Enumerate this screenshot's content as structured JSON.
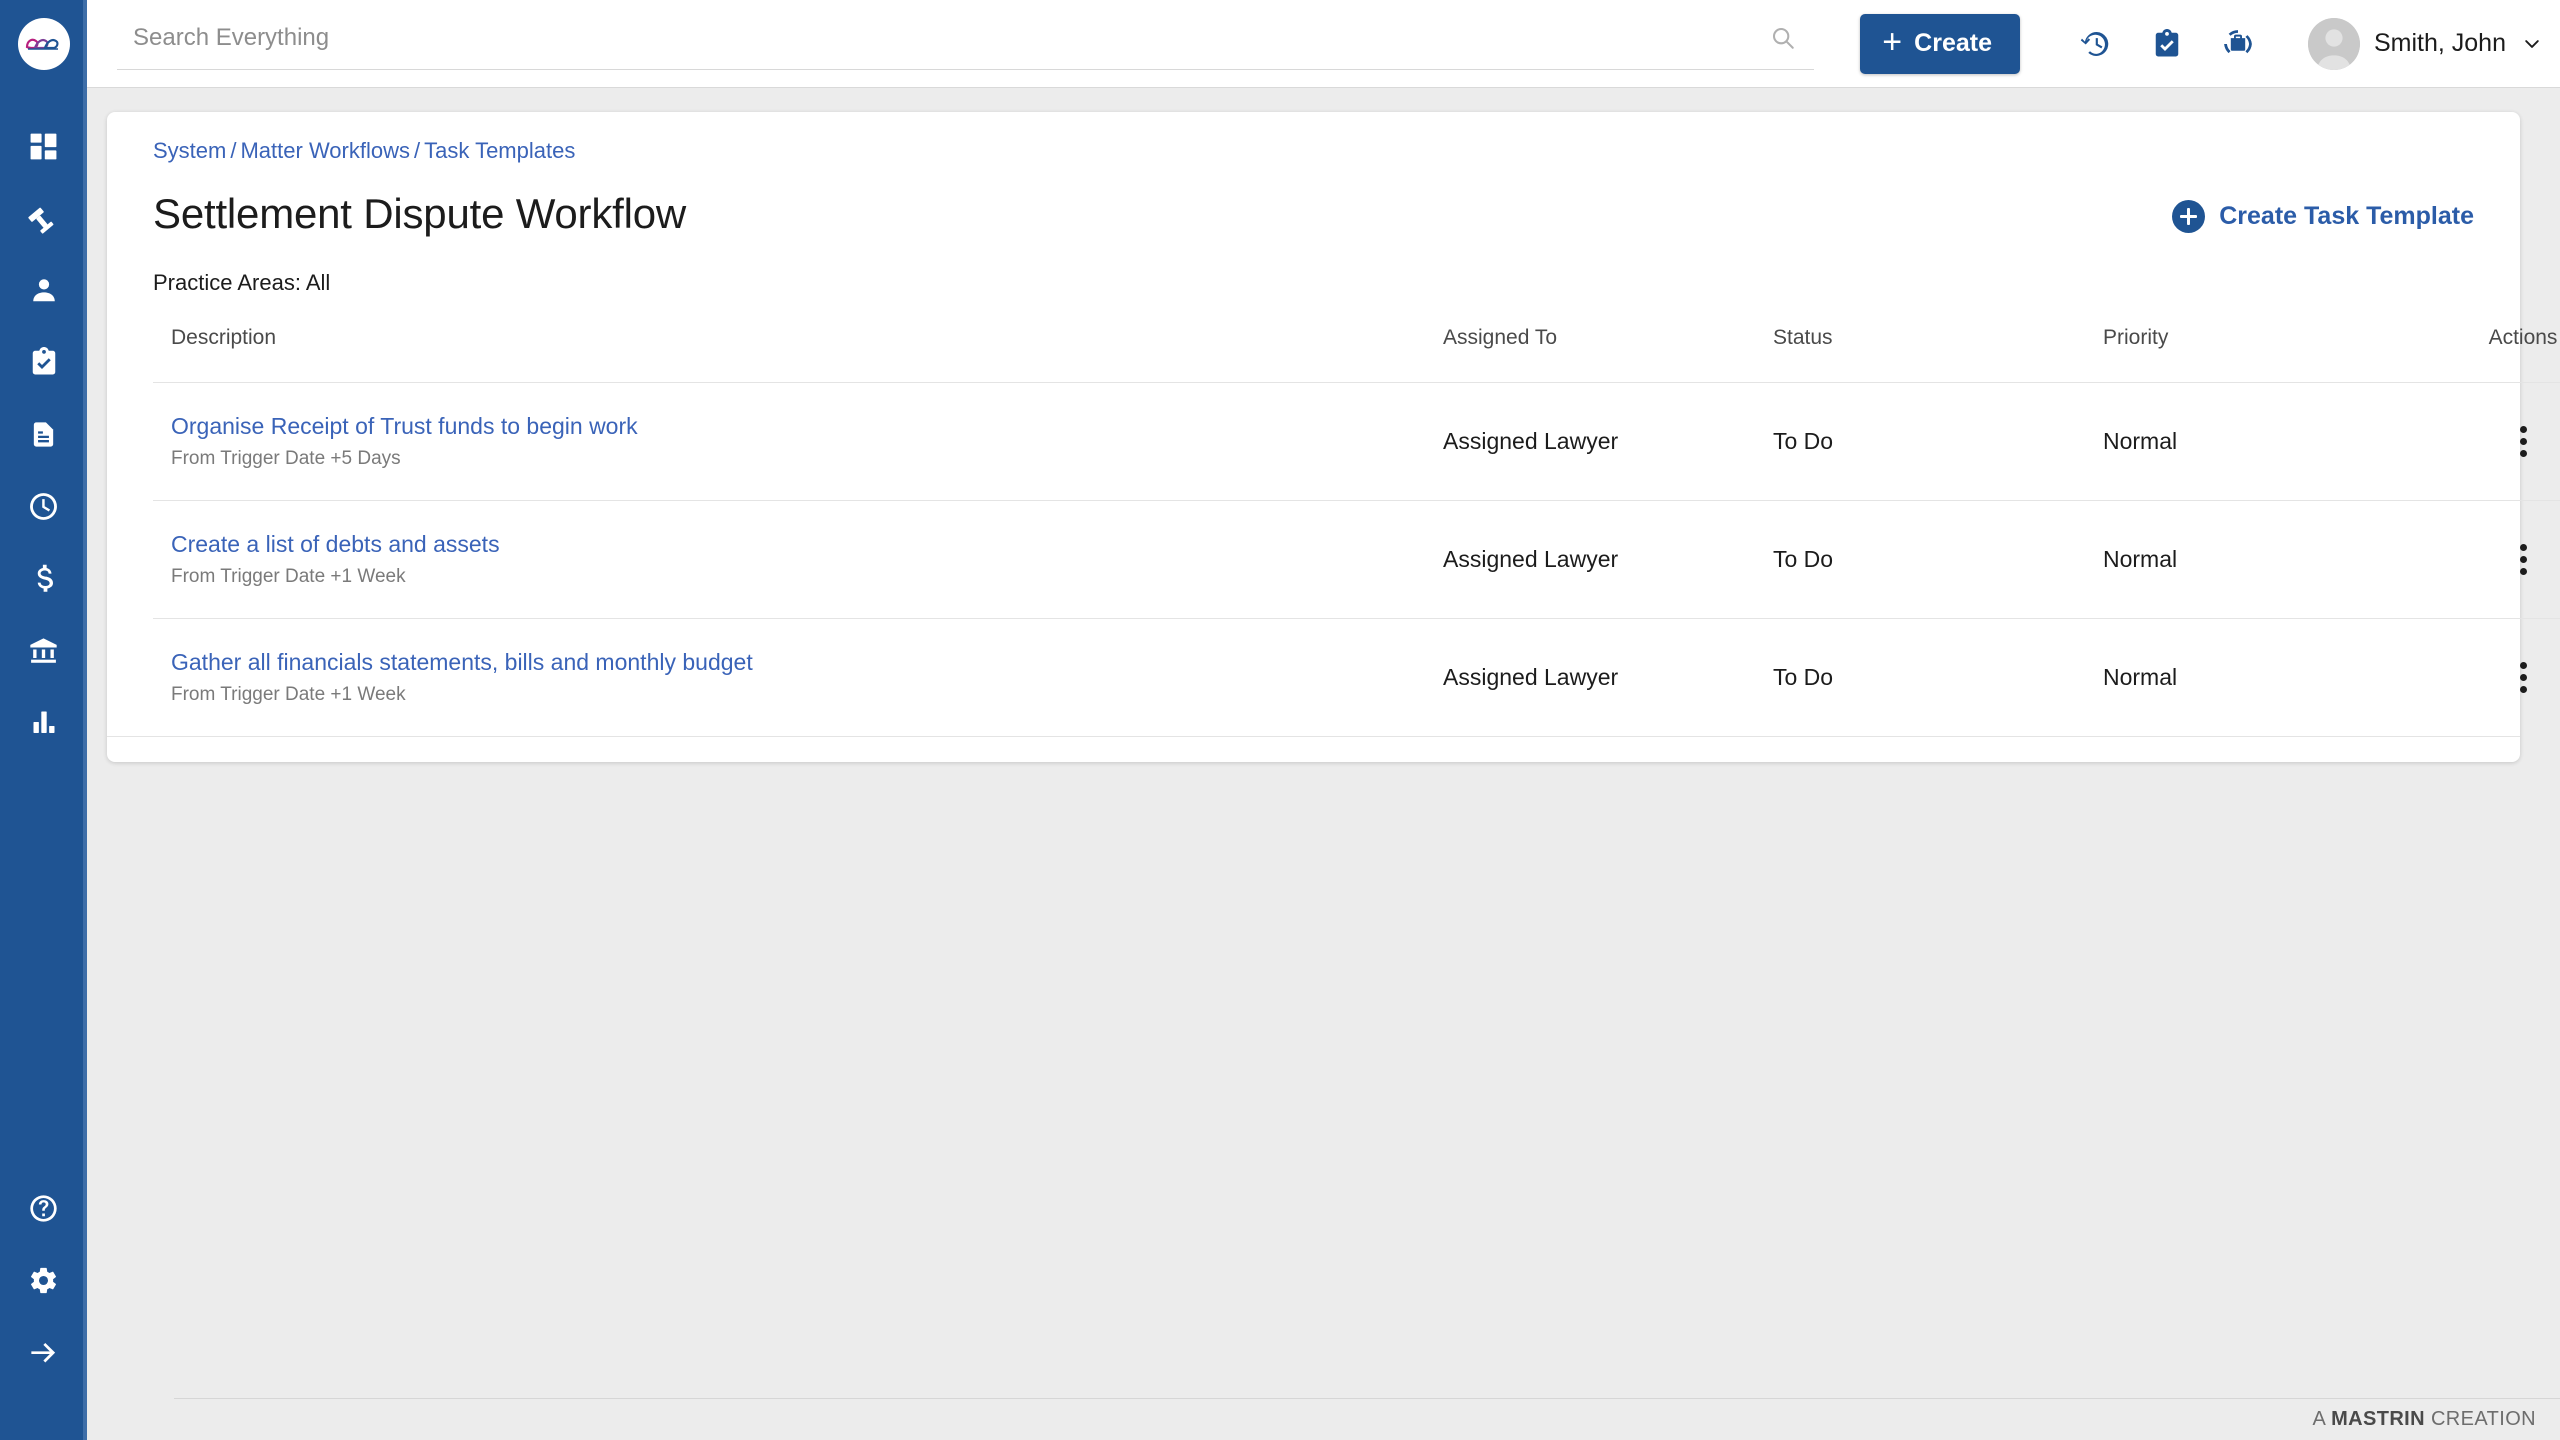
{
  "brand": {
    "logo_icon": "mastrin-ribbon-logo",
    "colors": {
      "sidebar": "#1F5493",
      "accent": "#1F5493",
      "link": "#3A63B8",
      "page_bg": "#ECECEC"
    }
  },
  "sidebar": {
    "top_items": [
      {
        "icon": "dashboard-grid-icon",
        "label": "Dashboard"
      },
      {
        "icon": "gavel-icon",
        "label": "Matters"
      },
      {
        "icon": "person-icon",
        "label": "Contacts"
      },
      {
        "icon": "clipboard-check-icon",
        "label": "Tasks"
      },
      {
        "icon": "document-icon",
        "label": "Documents"
      },
      {
        "icon": "clock-icon",
        "label": "Time"
      },
      {
        "icon": "dollar-icon",
        "label": "Billing"
      },
      {
        "icon": "bank-icon",
        "label": "Trust"
      },
      {
        "icon": "bar-chart-icon",
        "label": "Reports"
      }
    ],
    "bottom_items": [
      {
        "icon": "help-circle-icon",
        "label": "Help"
      },
      {
        "icon": "gear-icon",
        "label": "Settings"
      },
      {
        "icon": "arrow-right-icon",
        "label": "Expand"
      }
    ]
  },
  "topbar": {
    "search": {
      "placeholder": "Search Everything",
      "value": "",
      "icon": "search-icon"
    },
    "create_button": {
      "label": "Create",
      "plus": "+"
    },
    "icons": [
      {
        "icon": "history-clock-icon",
        "label": "Recent"
      },
      {
        "icon": "clipboard-check-icon",
        "label": "My Tasks"
      },
      {
        "icon": "briefcase-circle-icon",
        "label": "My Matters"
      }
    ],
    "user": {
      "name": "Smith, John",
      "avatar_icon": "avatar",
      "chevron_icon": "chevron-down-icon"
    }
  },
  "page": {
    "breadcrumb": {
      "items": [
        "System",
        "Matter Workflows",
        "Task Templates"
      ],
      "separator": "/"
    },
    "title": "Settlement Dispute Workflow",
    "practice_areas": "Practice Areas: All",
    "create_task_template": {
      "label": "Create Task Template",
      "icon": "circle-plus-icon"
    }
  },
  "table": {
    "columns": [
      "Description",
      "Assigned To",
      "Status",
      "Priority",
      "Actions"
    ],
    "rows": [
      {
        "description": "Organise Receipt of Trust funds to begin work",
        "sub": "From Trigger Date +5 Days",
        "assigned_to": "Assigned Lawyer",
        "status": "To Do",
        "priority": "Normal",
        "actions_icon": "kebab-menu-icon"
      },
      {
        "description": "Create a list of debts and assets",
        "sub": "From Trigger Date +1 Week",
        "assigned_to": "Assigned Lawyer",
        "status": "To Do",
        "priority": "Normal",
        "actions_icon": "kebab-menu-icon"
      },
      {
        "description": "Gather all financials statements, bills and monthly budget",
        "sub": "From Trigger Date +1 Week",
        "assigned_to": "Assigned Lawyer",
        "status": "To Do",
        "priority": "Normal",
        "actions_icon": "kebab-menu-icon"
      }
    ]
  },
  "footer": {
    "prefix": "A ",
    "brand": "MASTRIN",
    "suffix": " CREATION"
  }
}
